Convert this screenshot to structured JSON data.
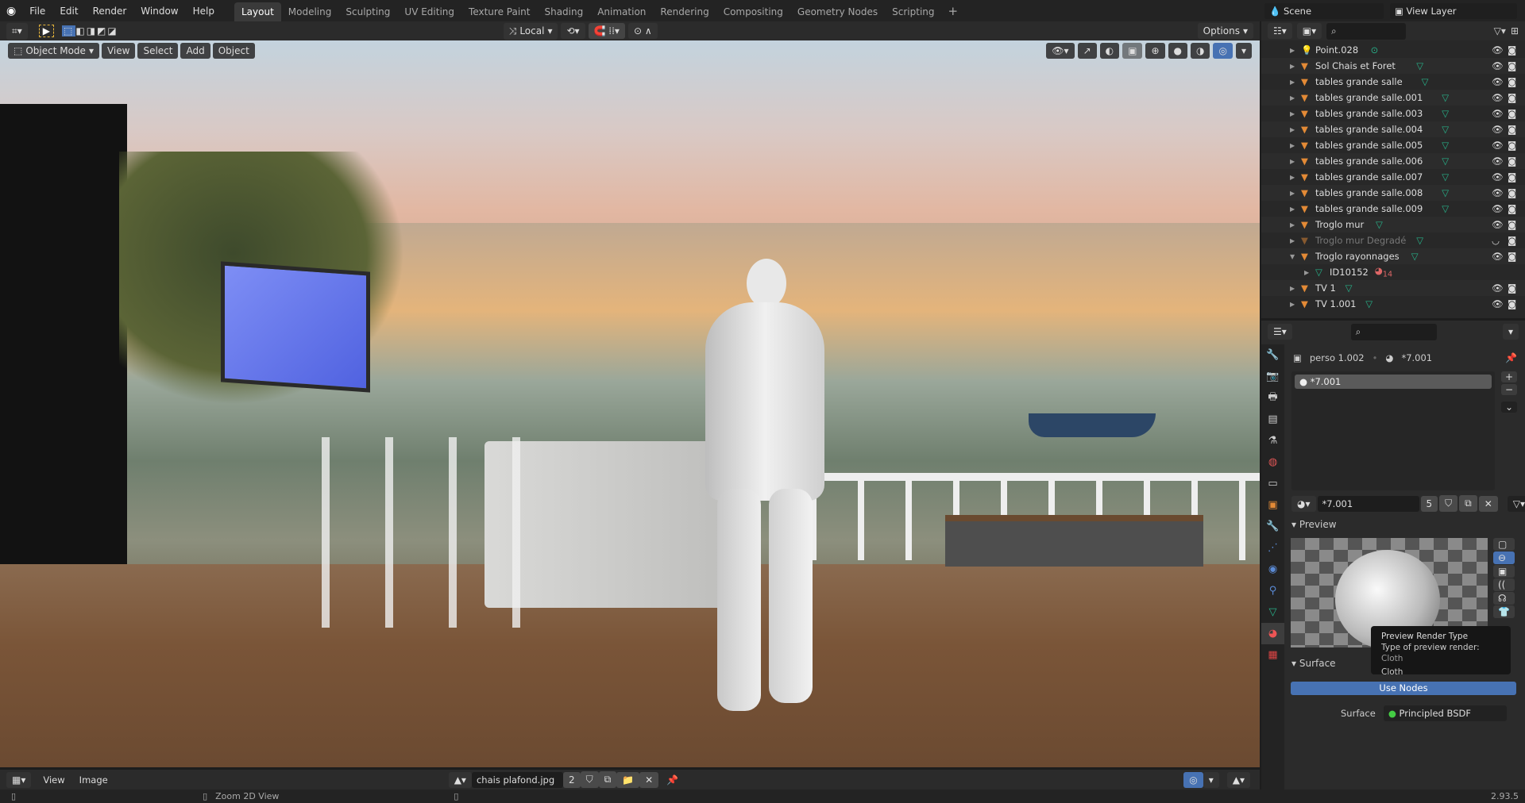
{
  "topbar": {
    "menus": [
      "File",
      "Edit",
      "Render",
      "Window",
      "Help"
    ],
    "workspaces": [
      "Layout",
      "Modeling",
      "Sculpting",
      "UV Editing",
      "Texture Paint",
      "Shading",
      "Animation",
      "Rendering",
      "Compositing",
      "Geometry Nodes",
      "Scripting"
    ],
    "active_workspace": "Layout",
    "add_tab": "+",
    "scene": "Scene",
    "view_layer": "View Layer"
  },
  "header": {
    "transform_orientation": "Local",
    "options": "Options"
  },
  "viewport": {
    "mode": "Object Mode",
    "menus": [
      "View",
      "Select",
      "Add",
      "Object"
    ]
  },
  "outliner": {
    "items": [
      {
        "name": "Point.028",
        "type": "light",
        "expanded": false,
        "visible": true
      },
      {
        "name": "Sol Chais et Foret",
        "type": "mesh",
        "visible": true
      },
      {
        "name": "tables grande salle",
        "type": "mesh",
        "visible": true
      },
      {
        "name": "tables grande salle.001",
        "type": "mesh",
        "visible": true
      },
      {
        "name": "tables grande salle.003",
        "type": "mesh",
        "visible": true
      },
      {
        "name": "tables grande salle.004",
        "type": "mesh",
        "visible": true
      },
      {
        "name": "tables grande salle.005",
        "type": "mesh",
        "visible": true
      },
      {
        "name": "tables grande salle.006",
        "type": "mesh",
        "visible": true
      },
      {
        "name": "tables grande salle.007",
        "type": "mesh",
        "visible": true
      },
      {
        "name": "tables grande salle.008",
        "type": "mesh",
        "visible": true
      },
      {
        "name": "tables grande salle.009",
        "type": "mesh",
        "visible": true
      },
      {
        "name": "Troglo mur",
        "type": "mesh",
        "visible": true
      },
      {
        "name": "Troglo mur Degradé",
        "type": "mesh",
        "visible": false
      },
      {
        "name": "Troglo rayonnages",
        "type": "mesh",
        "expanded": true,
        "visible": true
      },
      {
        "name": "ID10152",
        "type": "meshdata",
        "child": true,
        "badge": "14"
      },
      {
        "name": "TV 1",
        "type": "mesh",
        "visible": true
      },
      {
        "name": "TV 1.001",
        "type": "mesh",
        "visible": true
      }
    ]
  },
  "properties": {
    "object": "perso 1.002",
    "material": "*7.001",
    "slot": "*7.001",
    "material_field": "*7.001",
    "users": "5",
    "preview_label": "Preview",
    "surface_label": "Surface",
    "use_nodes": "Use Nodes",
    "surface_field_label": "Surface",
    "surface_value": "Principled BSDF",
    "tooltip": {
      "title": "Preview Render Type",
      "desc_label": "Type of preview render:",
      "desc_value": "Cloth",
      "value": "Cloth"
    }
  },
  "image_editor": {
    "menus": [
      "View",
      "Image"
    ],
    "image": "chais plafond.jpg",
    "users": "2"
  },
  "status": {
    "hint": "Zoom 2D View",
    "version": "2.93.5"
  },
  "colors": {
    "accent": "#4772b3",
    "mesh": "#e38a36",
    "data": "#27b38a"
  }
}
